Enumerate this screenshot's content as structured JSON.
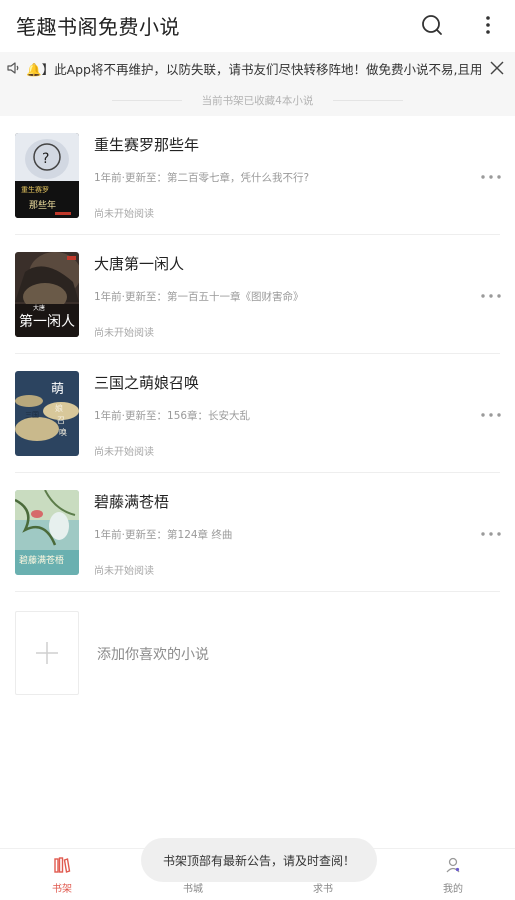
{
  "header": {
    "title": "笔趣书阁免费小说"
  },
  "notice": {
    "text": "🔔】此App将不再维护，以防失联，请书友们尽快转移阵地！做免费小说不易,且用且珍惜"
  },
  "shelf": {
    "summary": "当前书架已收藏4本小说"
  },
  "books": [
    {
      "title": "重生赛罗那些年",
      "update": "1年前·更新至：第二百零七章，凭什么我不行?",
      "status": "尚未开始阅读",
      "cover_text": "重生赛罗那些年"
    },
    {
      "title": "大唐第一闲人",
      "update": "1年前·更新至：第一百五十一章《图财害命》",
      "status": "尚未开始阅读",
      "cover_text": "大唐第一闲人"
    },
    {
      "title": "三国之萌娘召唤",
      "update": "1年前·更新至：156章：长安大乱",
      "status": "尚未开始阅读",
      "cover_text": "萌娘召唤"
    },
    {
      "title": "碧藤满苍梧",
      "update": "1年前·更新至：第124章 终曲",
      "status": "尚未开始阅读",
      "cover_text": "碧藤满苍梧"
    }
  ],
  "add": {
    "label": "添加你喜欢的小说"
  },
  "tabs": [
    {
      "label": "书架",
      "icon": "bookshelf-icon",
      "active": true
    },
    {
      "label": "书城",
      "icon": "bookstore-icon",
      "active": false
    },
    {
      "label": "求书",
      "icon": "request-book-icon",
      "active": false
    },
    {
      "label": "我的",
      "icon": "profile-icon",
      "active": false
    }
  ],
  "toast": {
    "text": "书架顶部有最新公告，请及时查阅！"
  },
  "colors": {
    "accent": "#e05a4f",
    "notice_bg": "#f6f6f6",
    "toast_bg": "#efefef"
  }
}
